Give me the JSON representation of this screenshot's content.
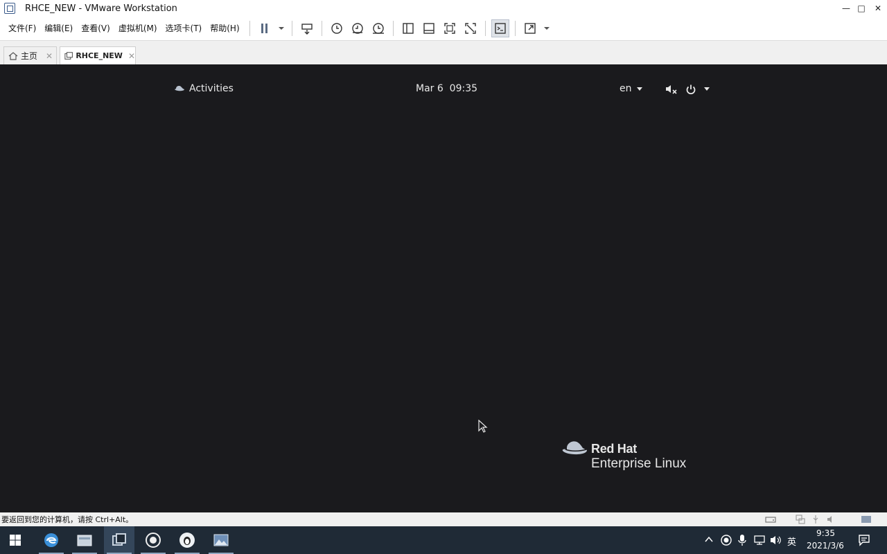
{
  "window": {
    "title": "RHCE_NEW - VMware Workstation",
    "minimize_glyph": "—",
    "maximize_glyph": "□",
    "close_glyph": "✕"
  },
  "menu": {
    "items": [
      "文件(F)",
      "编辑(E)",
      "查看(V)",
      "虚拟机(M)",
      "选项卡(T)",
      "帮助(H)"
    ]
  },
  "tabs": [
    {
      "label": "主页",
      "icon": "home-icon"
    },
    {
      "label": "RHCE_NEW",
      "icon": "vm-icon",
      "active": true
    }
  ],
  "tab_close_glyph": "✕",
  "guest": {
    "activities": "Activities",
    "clock": "Mar 6  09:35",
    "input_lang": "en",
    "logo_brand": "Red Hat",
    "logo_product": "Enterprise Linux"
  },
  "status": {
    "message": "要返回到您的计算机，请按 Ctrl+Alt。"
  },
  "taskbar": {
    "ime": "英",
    "time": "9:35",
    "date": "2021/3/6"
  },
  "colors": {
    "vm_background": "#1a1a1d",
    "taskbar": "#1f2a36",
    "redhat_logo": "#bfc7d2"
  }
}
